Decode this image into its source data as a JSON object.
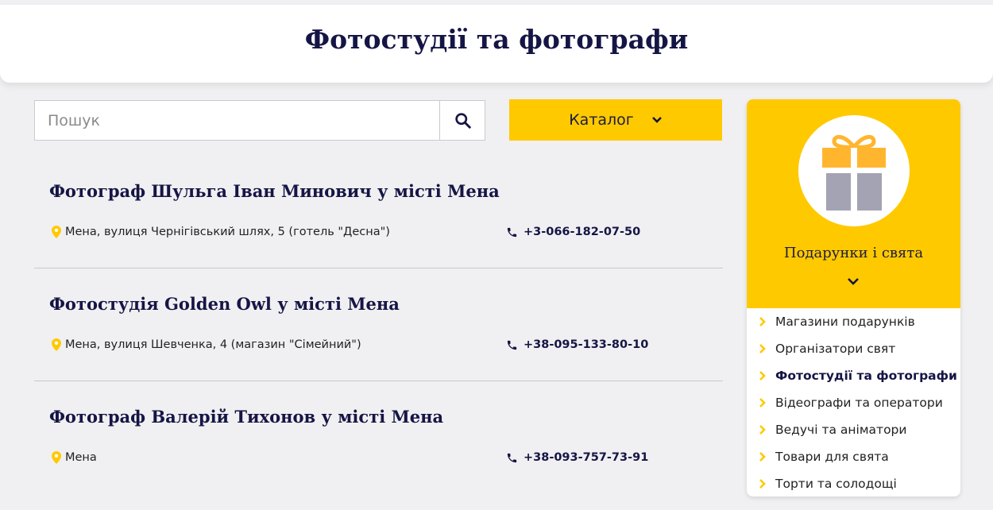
{
  "header": {
    "title": "Фотостудії та фотографи"
  },
  "search": {
    "placeholder": "Пошук",
    "value": ""
  },
  "catalog": {
    "label": "Каталог"
  },
  "listings": [
    {
      "title": "Фотограф Шульга Іван Минович у місті Мена",
      "address": "Мена, вулиця Чернігівський шлях, 5 (готель \"Десна\")",
      "phone": "+3-066-182-07-50"
    },
    {
      "title": "Фотостудія Golden Owl у місті Мена",
      "address": "Мена, вулиця Шевченка, 4 (магазин \"Сімейний\")",
      "phone": "+38-095-133-80-10"
    },
    {
      "title": "Фотограф Валерій Тихонов у місті Мена",
      "address": "Мена",
      "phone": "+38-093-757-73-91"
    }
  ],
  "sidebar": {
    "category": "Подарунки і свята",
    "icon": "gift-icon",
    "items": [
      {
        "label": "Магазини подарунків",
        "active": false
      },
      {
        "label": "Організатори свят",
        "active": false
      },
      {
        "label": "Фотостудії та фотографи",
        "active": true
      },
      {
        "label": "Відеографи та оператори",
        "active": false
      },
      {
        "label": "Ведучі та аніматори",
        "active": false
      },
      {
        "label": "Товари для свята",
        "active": false
      },
      {
        "label": "Торти та солодощі",
        "active": false
      }
    ]
  },
  "colors": {
    "accent": "#ffc900",
    "text_dark": "#151545",
    "background": "#f0f0f2",
    "gift_box": "#a3a3b3",
    "gift_ribbon": "#ffb62e"
  }
}
